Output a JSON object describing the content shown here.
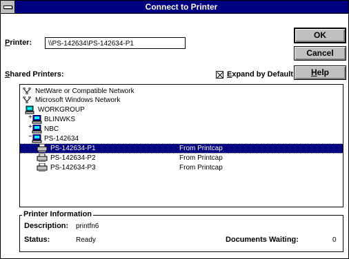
{
  "window": {
    "title": "Connect to Printer"
  },
  "printer": {
    "label": "Printer:",
    "value": "\\\\PS-142634\\PS-142634-P1"
  },
  "buttons": {
    "ok": "OK",
    "cancel": "Cancel",
    "help": "Help"
  },
  "shared": {
    "label": "Shared Printers:",
    "expand_label": "Expand by Default",
    "expand_checked": true
  },
  "tree": {
    "rows": [
      {
        "label": "NetWare or Compatible Network",
        "icon": "network-icon",
        "extra": ""
      },
      {
        "label": "Microsoft Windows Network",
        "icon": "network-icon",
        "extra": ""
      },
      {
        "label": "WORKGROUP",
        "icon": "workgroup-icon",
        "extra": ""
      },
      {
        "label": "BLINWKS",
        "icon": "computer-icon",
        "extra": ""
      },
      {
        "label": "NBC",
        "icon": "computer-icon",
        "extra": ""
      },
      {
        "label": "PS-142634",
        "icon": "computer-icon",
        "extra": ""
      },
      {
        "label": "PS-142634-P1",
        "icon": "printer-icon",
        "extra": "From Printcap",
        "selected": true
      },
      {
        "label": "PS-142634-P2",
        "icon": "printer-icon",
        "extra": "From Printcap"
      },
      {
        "label": "PS-142634-P3",
        "icon": "printer-icon",
        "extra": "From Printcap"
      }
    ]
  },
  "info": {
    "title": "Printer Information",
    "description_label": "Description:",
    "description_value": "printfn6",
    "status_label": "Status:",
    "status_value": "Ready",
    "docs_label": "Documents Waiting:",
    "docs_value": "0"
  },
  "colors": {
    "title_bar": "#000080",
    "selection": "#000080",
    "button_face": "#c0c0c0"
  }
}
